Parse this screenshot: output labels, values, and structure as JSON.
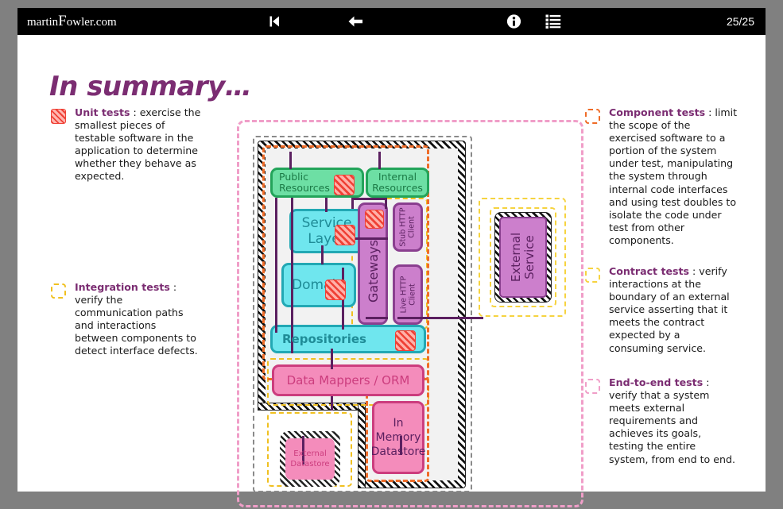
{
  "toolbar": {
    "brand_prefix": "martin",
    "brand_cap": "F",
    "brand_suffix": "owler.com",
    "icons": [
      {
        "name": "skip-to-start-icon",
        "glyph": "⏮"
      },
      {
        "name": "back-arrow-icon",
        "glyph": "←"
      },
      {
        "name": "info-icon",
        "glyph": "i"
      },
      {
        "name": "list-menu-icon",
        "glyph": "☰"
      }
    ],
    "page_indicator": "25/25"
  },
  "slide": {
    "title": "In summary…",
    "title_color": "#7b2d72"
  },
  "legend_left": [
    {
      "name": "unit-tests",
      "swatch": "hatched-red",
      "swatch_color": "#ef4136",
      "term": "Unit tests",
      "body": " : exercise the smallest pieces of testable software in the application to determine whether they behave as expected."
    },
    {
      "name": "integration-tests",
      "swatch": "dashed",
      "swatch_color": "#f0c020",
      "term": "Integration tests",
      "body": " : verify the communication paths and interactions between components to detect interface defects."
    }
  ],
  "legend_right": [
    {
      "name": "component-tests",
      "swatch": "dashed",
      "swatch_color": "#ef6c28",
      "term": "Component tests",
      "body": " : limit the scope of the exercised software to a portion of the system under test, manipulating the system through internal code interfaces and using test doubles to isolate the code under test from other components."
    },
    {
      "name": "contract-tests",
      "swatch": "dashed",
      "swatch_color": "#f6d340",
      "term": "Contract tests",
      "body": " : verify interactions at the boundary of an external service asserting that it meets the contract expected by a consuming service."
    },
    {
      "name": "end-to-end-tests",
      "swatch": "dashed",
      "swatch_color": "#f09ec8",
      "term": "End-to-end tests",
      "body": " : verify that a system meets external requirements and achieves its goals, testing the entire system, from end to end."
    }
  ],
  "diagram": {
    "boxes": {
      "public_resources": "Public\nResources",
      "public_resources_l1": "Public",
      "public_resources_l2": "Resources",
      "internal_resources_l1": "Internal",
      "internal_resources_l2": "Resources",
      "service_layer_l1": "Service",
      "service_layer_l2": "Layer",
      "domain": "Domain",
      "gateways": "Gateways",
      "stub_http_client_l1": "Stub HTTP",
      "stub_http_client_l2": "Client",
      "live_http_client_l1": "Live HTTP",
      "live_http_client_l2": "Client",
      "external_service_l1": "External",
      "external_service_l2": "Service",
      "repositories": "Repositories",
      "data_mappers": "Data Mappers / ORM",
      "external_datastore_l1": "External",
      "external_datastore_l2": "Datastore",
      "in_memory_datastore_l1": "In",
      "in_memory_datastore_l2": "Memory",
      "in_memory_datastore_l3": "Datastore"
    },
    "colors": {
      "green_fill": "#6ddfa4",
      "green_border": "#23a45a",
      "cyan_fill": "#6fe6ee",
      "cyan_border": "#22a8b4",
      "purple_fill": "#cc7fcc",
      "purple_border": "#8a3f8f",
      "pink_fill": "#f48cbb",
      "pink_border": "#cc3d7e",
      "connector": "#5b2060",
      "e2e_pink": "#f09ec8",
      "integration_yellow": "#f0c020",
      "contract_yellow": "#f6d340",
      "component_orange": "#ef6c28",
      "system_gray": "#8a8a8a"
    }
  }
}
